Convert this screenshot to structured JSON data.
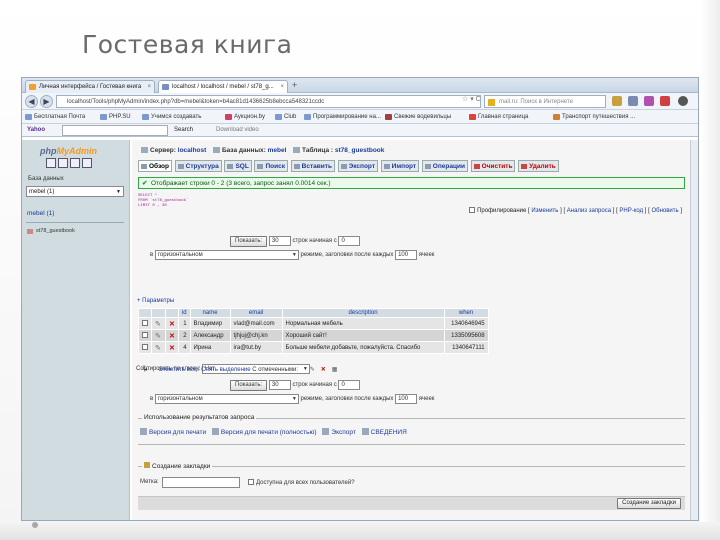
{
  "slide": {
    "title": "Гостевая книга"
  },
  "browser": {
    "tabs": [
      {
        "label": "Личная интерфейса / Гостевая книга"
      },
      {
        "label": "localhost / localhost / mebel / st78_g..."
      }
    ],
    "url": "localhost/Tools/phpMyAdmin/index.php?db=mebel&token=b4ac81d1436625b8ebcca548321ccdc",
    "search_placeholder": "mail.ru: Поиск в Интернете",
    "bookmarks": [
      "Бесплатная Почта",
      "PHP.SU",
      "Учимся создавать",
      "Аукцион.by",
      "Сlub",
      "Программирование на...",
      "Свежие водевильцы",
      "Главная страница",
      "Транспорт путешествия ..."
    ],
    "yahoo": {
      "logo": "Yahoo",
      "search": "Search",
      "download": "Download video"
    }
  },
  "pma": {
    "logo_php": "php",
    "logo_admin": "MyAdmin",
    "db_label": "База данных",
    "db_selected": "mebel (1)",
    "db_link": "mebel (1)",
    "table_link": "st78_guestbook"
  },
  "breadcrumb": {
    "server_label": "Сервер:",
    "server_value": "localhost",
    "db_label": "База данных:",
    "db_value": "mebel",
    "table_label": "Таблица :",
    "table_value": "st78_guestbook"
  },
  "tabs": [
    {
      "label": "Обзор",
      "active": true
    },
    {
      "label": "Структура"
    },
    {
      "label": "SQL"
    },
    {
      "label": "Поиск"
    },
    {
      "label": "Вставить"
    },
    {
      "label": "Экспорт"
    },
    {
      "label": "Импорт"
    },
    {
      "label": "Операции"
    },
    {
      "label": "Очистить",
      "danger": true
    },
    {
      "label": "Удалить",
      "danger": true
    }
  ],
  "message": "Отображает строки 0 - 2 (3 всего, запрос занял 0.0014 сек.)",
  "sql": {
    "line1": "SELECT *",
    "line2": "FROM `st78_guestbook`",
    "line3": "LIMIT 0 , 30"
  },
  "profiling": {
    "label": "Профилирование",
    "edit": "Изменить",
    "explain": "Анализ запроса",
    "php": "PHP-код",
    "refresh": "Обновить"
  },
  "nav_top": {
    "show_label": "Показать:",
    "rows": "30",
    "from_text": "строк начиная с",
    "start": "0",
    "in_text": "в",
    "mode": "горизонтальном",
    "mode_suffix": "режиме, заголовки после каждых",
    "headers": "100",
    "cells_text": "ячеек"
  },
  "sort": {
    "label": "Сортировать по ключу:",
    "value": "Нет"
  },
  "params_label": "+ Параметры",
  "table": {
    "columns": [
      "",
      "",
      "",
      "id",
      "name",
      "email",
      "description",
      "when"
    ],
    "rows": [
      {
        "id": "1",
        "name": "Владимир",
        "email": "vlad@mail.com",
        "description": "Нормальная мебель",
        "when": "1340646945"
      },
      {
        "id": "2",
        "name": "Александр",
        "email": "tjhjuj@chj.kn",
        "description": "Хороший сайт!",
        "when": "1335095608"
      },
      {
        "id": "4",
        "name": "Ирина",
        "email": "ira@tut.by",
        "description": "Больше мебели добавьте, пожалуйста. Спасибо",
        "when": "1340647111"
      }
    ]
  },
  "check_all": {
    "check": "Отметить все",
    "uncheck": "Снять выделение",
    "with_selected": "С отмеченными:"
  },
  "nav_bottom": {
    "show_label": "Показать:",
    "rows": "30",
    "from_text": "строк начиная с",
    "start": "0",
    "in_text": "в",
    "mode": "горизонтальном",
    "mode_suffix": "режиме, заголовки после каждых",
    "headers": "100",
    "cells_text": "ячеек"
  },
  "query_results": {
    "legend": "Использование результатов запроса",
    "print": "Версия для печати",
    "print_full": "Версия для печати (полностью)",
    "export": "Экспорт",
    "view": "СВЕДЕНИЯ"
  },
  "bookmark": {
    "legend": "Создание закладки",
    "label": "Метка:",
    "public": "Доступна для всех пользователей?",
    "submit": "Создание закладки"
  }
}
